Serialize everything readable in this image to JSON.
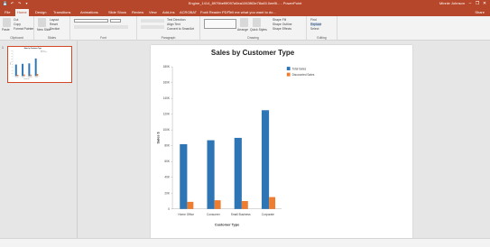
{
  "window": {
    "title": "Engine_1414_8979bef9f097a5ea1063f63e78a45.0eef8... - PowerPoint",
    "user": "Minnie Johnson",
    "minimize": "–",
    "maximize": "❐",
    "close": "✕"
  },
  "quick_access": [
    "💾",
    "↶",
    "↷",
    "▾"
  ],
  "ribbon_tabs": [
    "File",
    "Home",
    "Design",
    "Transitions",
    "Animations",
    "Slide Show",
    "Review",
    "View",
    "Add-ins",
    "ACROBAT",
    "Foxit Reader PDF"
  ],
  "active_tab_index": 1,
  "tell_me": "Tell me what you want to do...",
  "share_label": "Share",
  "ribbon": {
    "clipboard": {
      "label": "Clipboard",
      "paste": "Paste",
      "cut": "Cut",
      "copy": "Copy",
      "format_painter": "Format Painter"
    },
    "slides": {
      "label": "Slides",
      "new_slide": "New Slide",
      "layout": "Layout",
      "reset": "Reset",
      "section": "Section"
    },
    "font": {
      "label": "Font"
    },
    "paragraph": {
      "label": "Paragraph",
      "text_direction": "Text Direction",
      "align_text": "Align Text",
      "convert_smartart": "Convert to SmartArt"
    },
    "drawing": {
      "label": "Drawing",
      "arrange": "Arrange",
      "quick_styles": "Quick Styles",
      "shape_fill": "Shape Fill",
      "shape_outline": "Shape Outline",
      "shape_effects": "Shape Effects"
    },
    "editing": {
      "label": "Editing",
      "find": "Find",
      "replace": "Replace",
      "select": "Select"
    }
  },
  "slide_number": "1",
  "chart_data": {
    "type": "bar",
    "title": "Sales by Customer Type",
    "xlabel": "Customer Type",
    "ylabel": "Sales $",
    "categories": [
      "Home Office",
      "Consumer",
      "Small Business",
      "Corporate"
    ],
    "series": [
      {
        "name": "Total Sales",
        "color": "#2e75b6",
        "values": [
          82000,
          87000,
          90000,
          125000
        ]
      },
      {
        "name": "Discounted Sales",
        "color": "#ed7d31",
        "values": [
          9000,
          11000,
          10000,
          15000
        ]
      }
    ],
    "ylim": [
      0,
      180000
    ],
    "yticks": [
      "0",
      "20K",
      "40K",
      "60K",
      "80K",
      "100K",
      "120K",
      "140K",
      "160K",
      "180K"
    ],
    "grid": false,
    "legend": "top-right"
  }
}
